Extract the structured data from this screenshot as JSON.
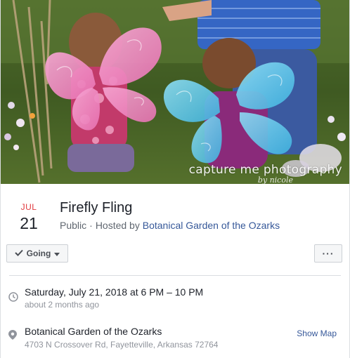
{
  "cover": {
    "watermark": "capture me photography",
    "watermark_sub": "by nicole"
  },
  "event": {
    "month": "JUL",
    "day": "21",
    "title": "Firefly Fling",
    "privacy": "Public",
    "separator": "·",
    "hosted_by_prefix": "Hosted by",
    "host": "Botanical Garden of the Ozarks"
  },
  "actions": {
    "going_label": "Going",
    "more_label": "···"
  },
  "details": {
    "datetime": "Saturday, July 21, 2018 at 6 PM – 10 PM",
    "relative_time": "about 2 months ago",
    "location_name": "Botanical Garden of the Ozarks",
    "address": "4703 N Crossover Rd, Fayetteville, Arkansas 72764",
    "show_map": "Show Map"
  },
  "colors": {
    "month": "#e0393e",
    "link": "#365899",
    "muted": "#90949c",
    "pink_wings": "#f08cc4",
    "blue_wings": "#5cc8ea"
  },
  "icons": {
    "check": "check-icon",
    "dropdown": "caret-down-icon",
    "clock": "clock-icon",
    "pin": "map-pin-icon"
  }
}
